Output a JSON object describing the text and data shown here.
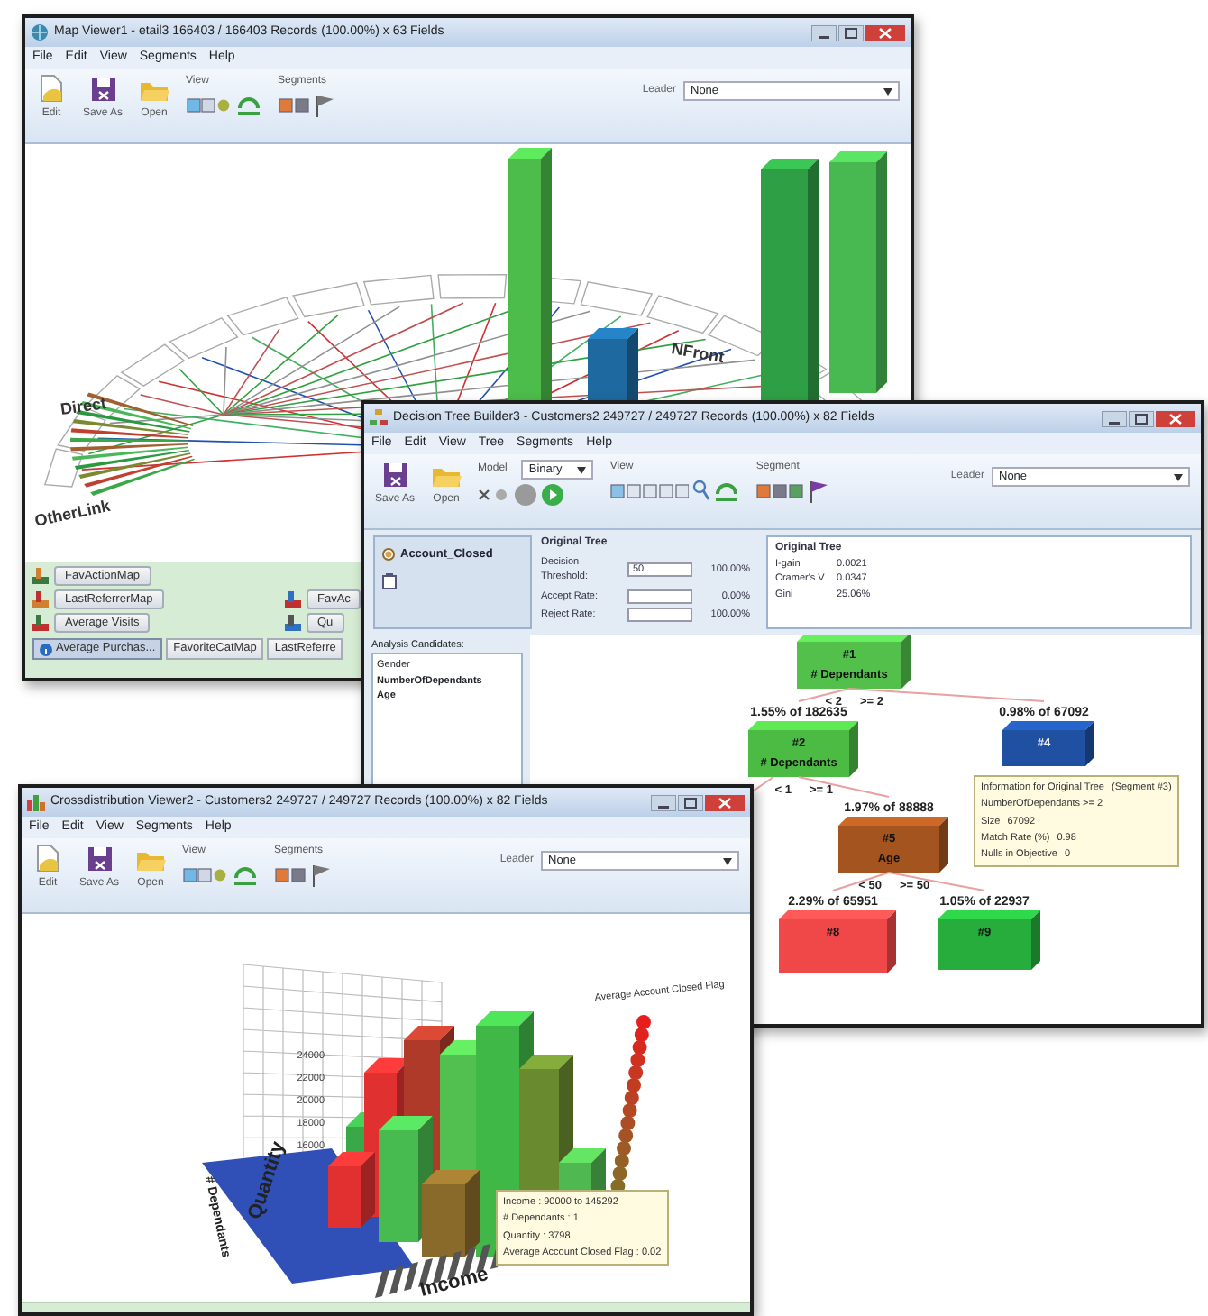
{
  "windows": [
    {
      "kind": "map",
      "title": "Map Viewer1 - etail3  166403 / 166403 Records (100.00%) x 63 Fields",
      "menu": [
        "File",
        "Edit",
        "View",
        "Segments",
        "Help"
      ],
      "toolbar": [
        {
          "kind": "edit",
          "label": "Edit"
        },
        {
          "kind": "save",
          "label": "Save As"
        },
        {
          "kind": "open",
          "label": "Open"
        },
        {
          "kind": "view",
          "label": "View"
        },
        {
          "kind": "segments",
          "label": "Segments"
        },
        {
          "kind": "leader",
          "label": "Leader",
          "value": "None"
        }
      ],
      "map_labels": [
        "Direct",
        "OtherLink",
        "NFront"
      ],
      "panel": {
        "rows": [
          {
            "left": "FavActionMap"
          },
          {
            "left": "LastReferrerMap",
            "right": "FavAc"
          },
          {
            "left": "Average Visits",
            "right": "Qu"
          }
        ],
        "tabs": [
          {
            "label": "Average Purchas...",
            "selected": true
          },
          {
            "label": "FavoriteCatMap",
            "selected": false
          },
          {
            "label": "LastReferre",
            "selected": false
          }
        ]
      }
    },
    {
      "kind": "tree",
      "title": "Decision Tree Builder3 - Customers2  249727 / 249727 Records (100.00%) x 82 Fields",
      "menu": [
        "File",
        "Edit",
        "View",
        "Tree",
        "Segments",
        "Help"
      ],
      "toolbar": [
        {
          "kind": "save",
          "label": "Save As"
        },
        {
          "kind": "open",
          "label": "Open"
        },
        {
          "kind": "model",
          "label": "Model",
          "value": "Binary"
        },
        {
          "kind": "view-tree",
          "label": "View"
        },
        {
          "kind": "segments-tree",
          "label": "Segment"
        },
        {
          "kind": "leader",
          "label": "Leader",
          "value": "None"
        }
      ],
      "targets": [
        {
          "label": "Account_Closed",
          "selected": true
        }
      ],
      "settings": {
        "title": "Original Tree",
        "rows": [
          {
            "label": "Decision Threshold:",
            "value": "50",
            "percent": "100.00%"
          },
          {
            "label": "Accept Rate:",
            "percent": "0.00%"
          },
          {
            "label": "Reject Rate:",
            "percent": "100.00%"
          }
        ]
      },
      "stats": {
        "title": "Original Tree",
        "rows": [
          {
            "label": "I-gain",
            "value": "0.0021"
          },
          {
            "label": "Cramer's V",
            "value": "0.0347"
          },
          {
            "label": "Gini",
            "value": "25.06%"
          }
        ]
      },
      "candidates": {
        "title": "Analysis Candidates:",
        "items": [
          {
            "label": "Gender",
            "used": false
          },
          {
            "label": "NumberOfDependants",
            "used": true
          },
          {
            "label": "Age",
            "used": true
          }
        ]
      },
      "tree": {
        "label": "#1",
        "split": "# Dependants",
        "branches": [
          "< 2",
          ">= 2"
        ],
        "color": "#52c04a",
        "children": [
          {
            "caption": "1.55% of 182635",
            "label": "#2",
            "split": "# Dependants",
            "branches": [
              "< 1",
              ">= 1"
            ],
            "color": "#4cbb44",
            "children": [
              {
                "caption": "1.97% of 88888",
                "label": "#5",
                "split": "Age",
                "branches": [
                  "< 50",
                  ">= 50"
                ],
                "color": "#a4541e",
                "children": [
                  {
                    "caption": "2.29% of 65951",
                    "label": "#8",
                    "color": "#f04848"
                  },
                  {
                    "caption": "1.05% of 22937",
                    "label": "#9",
                    "color": "#26ad3c"
                  }
                ]
              }
            ]
          },
          {
            "caption": "0.98% of 67092",
            "label": "#4",
            "color": "#1f50a2"
          }
        ]
      },
      "tooltip": [
        {
          "label": "Information for Original Tree",
          "value": "(Segment #3)"
        },
        {
          "label": "NumberOfDependants >= 2"
        },
        {
          "label": "Size",
          "value": "67092"
        },
        {
          "label": "Match Rate (%)",
          "value": "0.98"
        },
        {
          "label": "Nulls in Objective",
          "value": "0"
        }
      ]
    },
    {
      "kind": "cross",
      "title": "Crossdistribution Viewer2 - Customers2  249727 / 249727 Records (100.00%) x 82 Fields",
      "menu": [
        "File",
        "Edit",
        "View",
        "Segments",
        "Help"
      ],
      "toolbar": [
        {
          "kind": "edit",
          "label": "Edit"
        },
        {
          "kind": "save",
          "label": "Save As"
        },
        {
          "kind": "open",
          "label": "Open"
        },
        {
          "kind": "view",
          "label": "View"
        },
        {
          "kind": "segments",
          "label": "Segments"
        },
        {
          "kind": "leader",
          "label": "Leader",
          "value": "None"
        }
      ],
      "chart": {
        "ticks": [
          "24000",
          "22000",
          "20000",
          "18000",
          "16000"
        ],
        "y_axis": "Quantity",
        "depth_axis": "# Dependants",
        "x_axis": "Income",
        "scale_title": "Average Account Closed Flag",
        "tooltip": [
          "Income : 90000 to 145292",
          "# Dependants : 1",
          "Quantity : 3798",
          "Average Account Closed Flag : 0.02"
        ]
      }
    }
  ]
}
